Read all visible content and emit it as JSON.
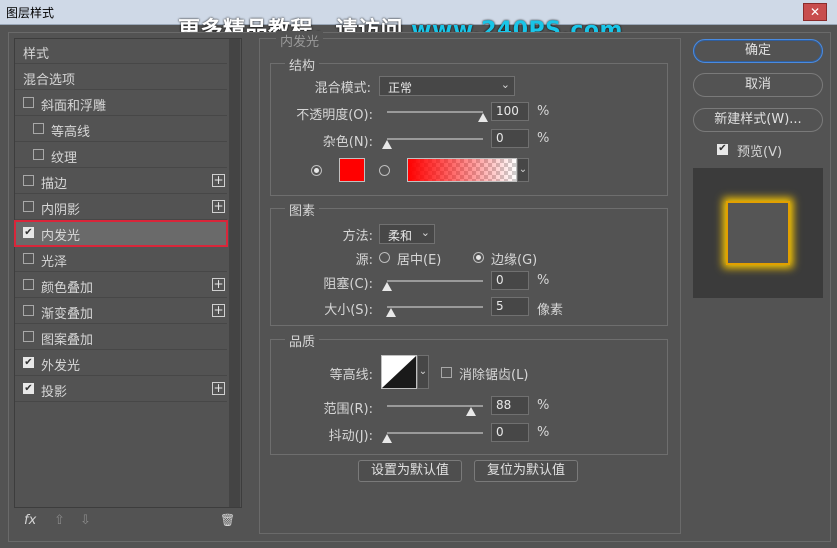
{
  "window": {
    "title": "图层样式",
    "close_label": "✕"
  },
  "watermark": {
    "text": "更多精品教程，请访问 ",
    "site": "www.240PS.com"
  },
  "sidebar": {
    "items": [
      {
        "label": "样式",
        "checkbox": null,
        "plus": false,
        "indent": 0
      },
      {
        "label": "混合选项",
        "checkbox": null,
        "plus": false,
        "indent": 0
      },
      {
        "label": "斜面和浮雕",
        "checkbox": false,
        "plus": false,
        "indent": 0
      },
      {
        "label": "等高线",
        "checkbox": false,
        "plus": false,
        "indent": 1
      },
      {
        "label": "纹理",
        "checkbox": false,
        "plus": false,
        "indent": 1
      },
      {
        "label": "描边",
        "checkbox": false,
        "plus": true,
        "indent": 0
      },
      {
        "label": "内阴影",
        "checkbox": false,
        "plus": true,
        "indent": 0
      },
      {
        "label": "内发光",
        "checkbox": true,
        "plus": false,
        "indent": 0,
        "selected": true
      },
      {
        "label": "光泽",
        "checkbox": false,
        "plus": false,
        "indent": 0
      },
      {
        "label": "颜色叠加",
        "checkbox": false,
        "plus": true,
        "indent": 0
      },
      {
        "label": "渐变叠加",
        "checkbox": false,
        "plus": true,
        "indent": 0
      },
      {
        "label": "图案叠加",
        "checkbox": false,
        "plus": false,
        "indent": 0
      },
      {
        "label": "外发光",
        "checkbox": true,
        "plus": false,
        "indent": 0
      },
      {
        "label": "投影",
        "checkbox": true,
        "plus": true,
        "indent": 0
      }
    ],
    "footer": {
      "fx": "fx",
      "up": "⇧",
      "down": "⇩",
      "trash": "🗑"
    }
  },
  "panel": {
    "title": "内发光",
    "structure": {
      "title": "结构",
      "blend_label": "混合模式:",
      "blend_value": "正常",
      "opacity_label": "不透明度(O):",
      "opacity_value": "100",
      "opacity_fraction": 1.0,
      "opacity_unit": "%",
      "noise_label": "杂色(N):",
      "noise_value": "0",
      "noise_fraction": 0.0,
      "noise_unit": "%",
      "color_swatch": "#ff0000",
      "gradient_from": "#ff0000"
    },
    "elements": {
      "title": "图素",
      "method_label": "方法:",
      "method_value": "柔和",
      "source_label": "源:",
      "center_label": "居中(E)",
      "edge_label": "边缘(G)",
      "choke_label": "阻塞(C):",
      "choke_value": "0",
      "choke_fraction": 0.0,
      "choke_unit": "%",
      "size_label": "大小(S):",
      "size_value": "5",
      "size_fraction": 0.04,
      "size_unit": "像素"
    },
    "quality": {
      "title": "品质",
      "contour_label": "等高线:",
      "antialias_label": "消除锯齿(L)",
      "range_label": "范围(R):",
      "range_value": "88",
      "range_fraction": 0.88,
      "range_unit": "%",
      "jitter_label": "抖动(J):",
      "jitter_value": "0",
      "jitter_fraction": 0.0,
      "jitter_unit": "%"
    },
    "set_default_label": "设置为默认值",
    "reset_default_label": "复位为默认值"
  },
  "right": {
    "ok_label": "确定",
    "cancel_label": "取消",
    "new_style_label": "新建样式(W)...",
    "preview_label": "预览(V)",
    "preview_checked": true,
    "glow_color": "#ffcc00"
  }
}
